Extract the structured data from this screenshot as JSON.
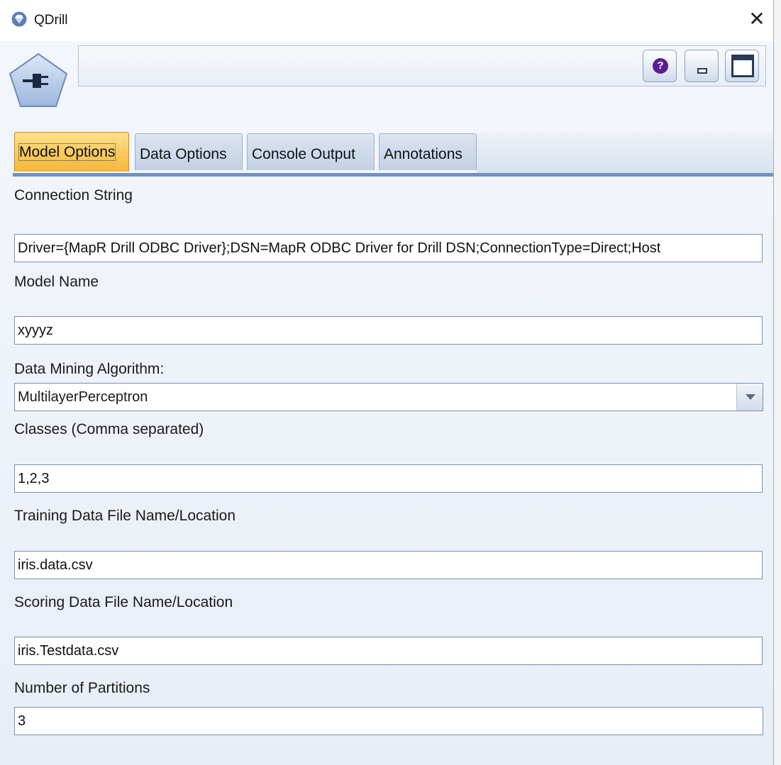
{
  "window": {
    "title": "QDrill",
    "close_glyph": "✕"
  },
  "icons": {
    "app": "gem-icon",
    "node": "plug-node-icon",
    "help": "question-icon",
    "minimize": "minimize-icon",
    "maximize": "maximize-icon"
  },
  "header": {
    "help_glyph": "?"
  },
  "tabs": [
    {
      "label": "Model Options",
      "active": true
    },
    {
      "label": "Data Options",
      "active": false
    },
    {
      "label": "Console Output",
      "active": false
    },
    {
      "label": "Annotations",
      "active": false
    }
  ],
  "form": {
    "connection_string": {
      "label": "Connection String",
      "value": "Driver={MapR Drill ODBC Driver};DSN=MapR ODBC Driver for Drill DSN;ConnectionType=Direct;Host"
    },
    "model_name": {
      "label": "Model Name",
      "value": "xyyyz"
    },
    "algorithm": {
      "label": "Data Mining Algorithm:",
      "value": "MultilayerPerceptron"
    },
    "classes": {
      "label": "Classes (Comma separated)",
      "value": "1,2,3"
    },
    "training_file": {
      "label": "Training Data File Name/Location",
      "value": "iris.data.csv"
    },
    "scoring_file": {
      "label": "Scoring Data File Name/Location",
      "value": "iris.Testdata.csv"
    },
    "partitions": {
      "label": "Number of Partitions",
      "value": "3"
    }
  },
  "colors": {
    "active_tab": "#f4b63a",
    "tab_underline": "#6e92c4",
    "help_button": "#5a1f8c"
  }
}
